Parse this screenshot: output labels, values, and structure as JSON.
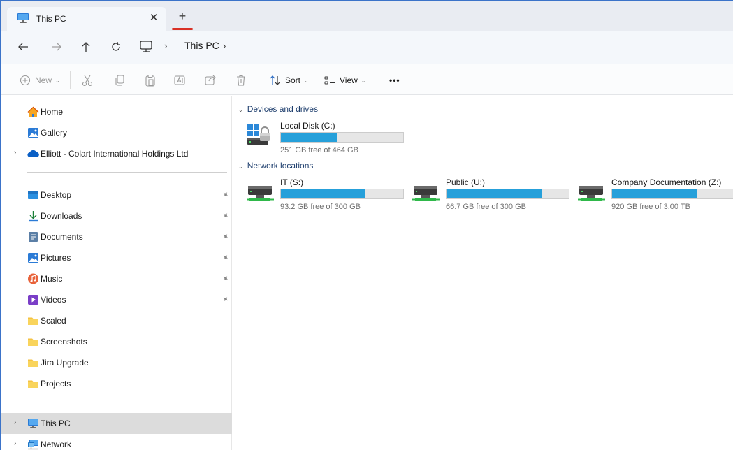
{
  "tab": {
    "title": "This PC",
    "close": "✕",
    "new_tab": "+"
  },
  "address": {
    "crumbs": [
      "This PC"
    ],
    "separator": "›"
  },
  "toolbar": {
    "new_label": "New",
    "sort_label": "Sort",
    "view_label": "View",
    "more_label": "•••",
    "chevron": "⌄"
  },
  "sidebar": {
    "top_items": [
      {
        "label": "Home",
        "icon": "home-icon"
      },
      {
        "label": "Gallery",
        "icon": "gallery-icon"
      },
      {
        "label": "Elliott - Colart International Holdings Ltd",
        "icon": "onedrive-icon",
        "expandable": true
      }
    ],
    "pinned": [
      {
        "label": "Desktop",
        "icon": "desktop-folder-icon",
        "pinned": true
      },
      {
        "label": "Downloads",
        "icon": "downloads-icon",
        "pinned": true
      },
      {
        "label": "Documents",
        "icon": "documents-icon",
        "pinned": true
      },
      {
        "label": "Pictures",
        "icon": "pictures-icon",
        "pinned": true
      },
      {
        "label": "Music",
        "icon": "music-icon",
        "pinned": true
      },
      {
        "label": "Videos",
        "icon": "videos-icon",
        "pinned": true
      },
      {
        "label": "Scaled",
        "icon": "folder-icon",
        "pinned": false
      },
      {
        "label": "Screenshots",
        "icon": "folder-icon",
        "pinned": false
      },
      {
        "label": "Jira Upgrade",
        "icon": "folder-icon",
        "pinned": false
      },
      {
        "label": "Projects",
        "icon": "folder-icon",
        "pinned": false
      }
    ],
    "bottom_items": [
      {
        "label": "This PC",
        "icon": "this-pc-icon",
        "selected": true
      },
      {
        "label": "Network",
        "icon": "network-icon",
        "selected": false
      }
    ],
    "expander": "›",
    "pin_glyph": "📌"
  },
  "main": {
    "devices_header": "Devices and drives",
    "network_header": "Network locations",
    "group_chevron": "⌄",
    "drives": [
      {
        "name": "Local Disk (C:)",
        "free_text": "251 GB free of 464 GB",
        "used_fraction": 0.459,
        "icon": "local-disk-icon"
      }
    ],
    "network_drives": [
      {
        "name": "IT (S:)",
        "free_text": "93.2 GB free of 300 GB",
        "used_fraction": 0.689,
        "icon": "network-drive-icon"
      },
      {
        "name": "Public (U:)",
        "free_text": "66.7 GB free of 300 GB",
        "used_fraction": 0.778,
        "icon": "network-drive-icon"
      },
      {
        "name": "Company Documentation (Z:)",
        "free_text": "920 GB free of 3.00 TB",
        "used_fraction": 0.7,
        "icon": "network-drive-icon"
      }
    ]
  },
  "colors": {
    "accent": "#26a0da",
    "window_border": "#3b73c9",
    "tab_underline": "#d93025",
    "folder": "#f5c242"
  }
}
